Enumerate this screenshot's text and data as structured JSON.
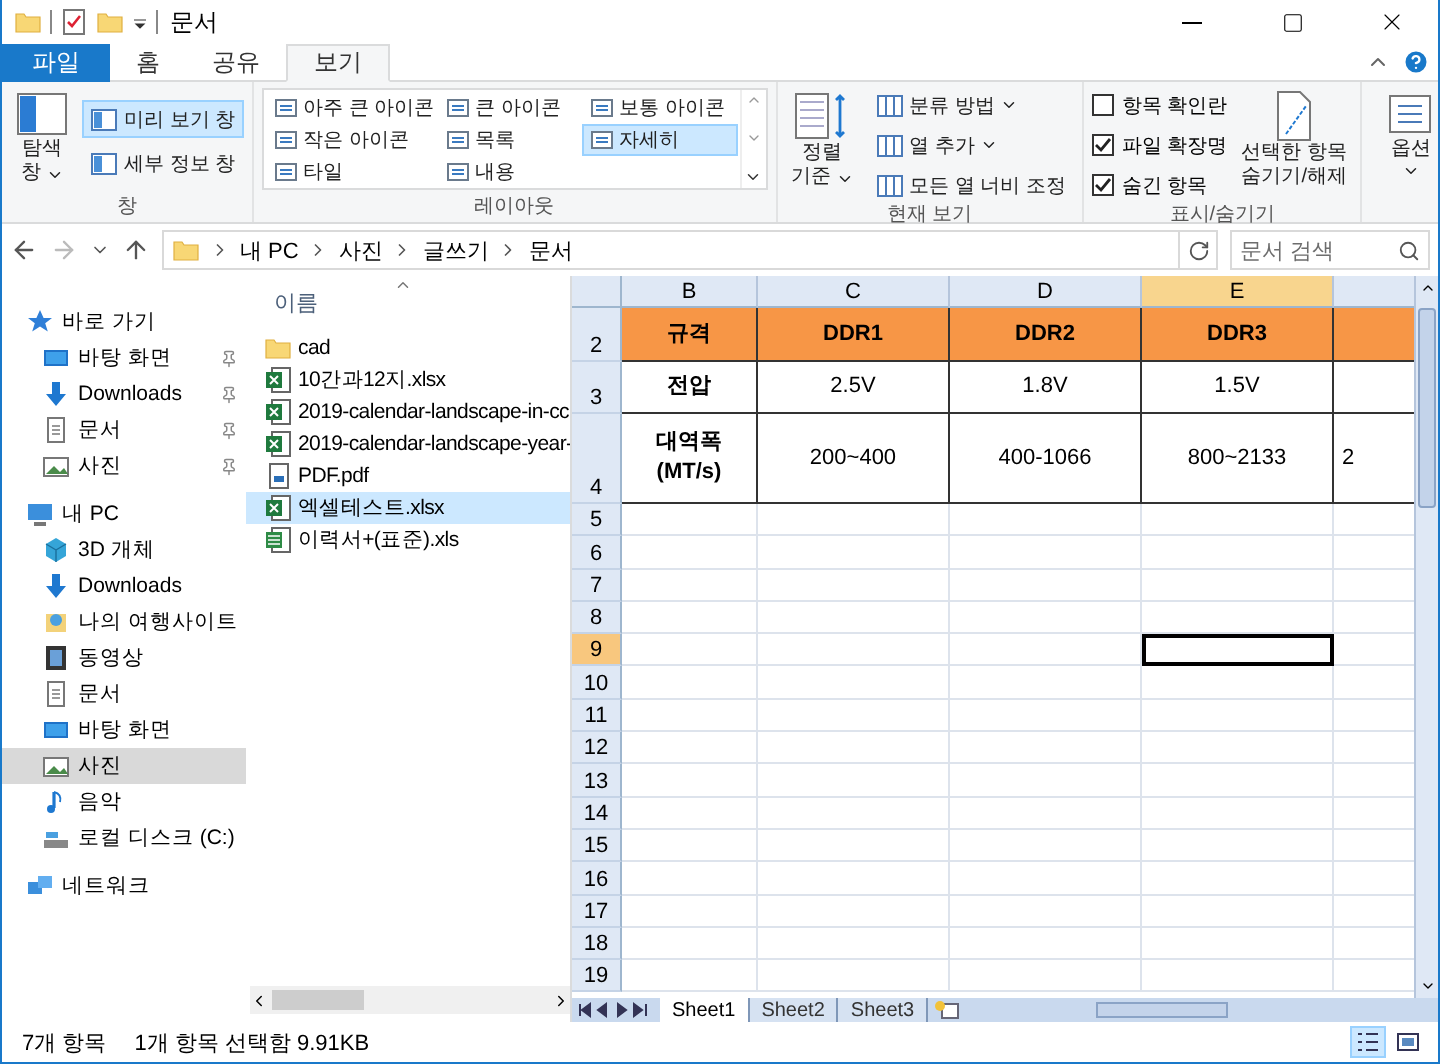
{
  "window": {
    "title": "문서"
  },
  "ribbon_tabs": [
    {
      "label": "파일",
      "kind": "file",
      "selected": false
    },
    {
      "label": "홈",
      "kind": "tab",
      "selected": false
    },
    {
      "label": "공유",
      "kind": "tab",
      "selected": false
    },
    {
      "label": "보기",
      "kind": "tab",
      "selected": true
    }
  ],
  "ribbon": {
    "panes": {
      "label": "창",
      "navigation_pane": [
        "탐색",
        "창"
      ],
      "buttons": [
        {
          "label": "미리 보기 창",
          "selected": true
        },
        {
          "label": "세부 정보 창",
          "selected": false
        }
      ]
    },
    "layout": {
      "label": "레이아웃",
      "options": [
        {
          "label": "아주 큰 아이콘",
          "selected": false
        },
        {
          "label": "큰 아이콘",
          "selected": false
        },
        {
          "label": "보통 아이콘",
          "selected": false
        },
        {
          "label": "작은 아이콘",
          "selected": false
        },
        {
          "label": "목록",
          "selected": false
        },
        {
          "label": "자세히",
          "selected": true
        },
        {
          "label": "타일",
          "selected": false
        },
        {
          "label": "내용",
          "selected": false
        }
      ]
    },
    "current_view": {
      "label": "현재 보기",
      "sort": [
        "정렬",
        "기준"
      ],
      "items": [
        {
          "label": "분류 방법",
          "dropdown": true
        },
        {
          "label": "열 추가",
          "dropdown": true
        },
        {
          "label": "모든 열 너비 조정",
          "dropdown": false
        }
      ]
    },
    "show_hide": {
      "label": "표시/숨기기",
      "checkboxes": [
        {
          "label": "항목 확인란",
          "checked": false
        },
        {
          "label": "파일 확장명",
          "checked": true
        },
        {
          "label": "숨긴 항목",
          "checked": true
        }
      ],
      "hide_selected": [
        "선택한 항목",
        "숨기기/해제"
      ]
    },
    "options": {
      "label": "옵션"
    }
  },
  "address_bar": {
    "path": [
      "내 PC",
      "사진",
      "글쓰기",
      "문서"
    ],
    "search_placeholder": "문서 검색"
  },
  "navigation_pane": [
    {
      "label": "바로 가기",
      "kind": "star",
      "selected": false,
      "children": [
        {
          "label": "바탕 화면",
          "kind": "desktop",
          "pinned": true,
          "selected": false
        },
        {
          "label": "Downloads",
          "kind": "download",
          "pinned": true,
          "selected": false
        },
        {
          "label": "문서",
          "kind": "document",
          "pinned": true,
          "selected": false
        },
        {
          "label": "사진",
          "kind": "picture",
          "pinned": true,
          "selected": false
        }
      ]
    },
    {
      "label": "내 PC",
      "kind": "pc",
      "selected": false,
      "children": [
        {
          "label": "3D 개체",
          "kind": "cube",
          "pinned": false,
          "selected": false
        },
        {
          "label": "Downloads",
          "kind": "download",
          "pinned": false,
          "selected": false
        },
        {
          "label": "나의 여행사이트",
          "kind": "site",
          "pinned": false,
          "selected": false
        },
        {
          "label": "동영상",
          "kind": "video",
          "pinned": false,
          "selected": false
        },
        {
          "label": "문서",
          "kind": "document",
          "pinned": false,
          "selected": false
        },
        {
          "label": "바탕 화면",
          "kind": "desktop",
          "pinned": false,
          "selected": false
        },
        {
          "label": "사진",
          "kind": "picture",
          "pinned": false,
          "selected": true
        },
        {
          "label": "음악",
          "kind": "music",
          "pinned": false,
          "selected": false
        },
        {
          "label": "로컬 디스크 (C:)",
          "kind": "disk",
          "pinned": false,
          "selected": false
        }
      ]
    },
    {
      "label": "네트워크",
      "kind": "network",
      "selected": false
    }
  ],
  "file_list": {
    "column": "이름",
    "files": [
      {
        "name": "cad",
        "kind": "folder",
        "selected": false
      },
      {
        "name": "10간과12지.xlsx",
        "kind": "excel",
        "selected": false
      },
      {
        "name": "2019-calendar-landscape-in-cc",
        "kind": "excel",
        "selected": false
      },
      {
        "name": "2019-calendar-landscape-year-",
        "kind": "excel",
        "selected": false
      },
      {
        "name": "PDF.pdf",
        "kind": "pdf",
        "selected": false
      },
      {
        "name": "엑셀테스트.xlsx",
        "kind": "excel",
        "selected": true
      },
      {
        "name": "이력서+(표준).xls",
        "kind": "xls",
        "selected": false
      }
    ]
  },
  "spreadsheet": {
    "columns": [
      {
        "label": "B",
        "selected": false
      },
      {
        "label": "C",
        "selected": false
      },
      {
        "label": "D",
        "selected": false
      },
      {
        "label": "E",
        "selected": true
      }
    ],
    "rows": [
      {
        "number": "2",
        "kind": "header",
        "selected": false,
        "cells": [
          "규격",
          "DDR1",
          "DDR2",
          "DDR3"
        ]
      },
      {
        "number": "3",
        "kind": "data",
        "selected": false,
        "cells": [
          "전압",
          "2.5V",
          "1.8V",
          "1.5V"
        ]
      },
      {
        "number": "4",
        "kind": "data",
        "selected": false,
        "cells": [
          "대역폭\n(MT/s)",
          "200~400",
          "400-1066",
          "800~2133"
        ],
        "cut_cell": "2"
      },
      {
        "number": "5",
        "kind": "empty",
        "selected": false
      },
      {
        "number": "6",
        "kind": "empty",
        "selected": false
      },
      {
        "number": "7",
        "kind": "empty",
        "selected": false
      },
      {
        "number": "8",
        "kind": "empty",
        "selected": false
      },
      {
        "number": "9",
        "kind": "empty",
        "selected": true
      },
      {
        "number": "10",
        "kind": "empty",
        "selected": false
      },
      {
        "number": "11",
        "kind": "empty",
        "selected": false
      },
      {
        "number": "12",
        "kind": "empty",
        "selected": false
      },
      {
        "number": "13",
        "kind": "empty",
        "selected": false
      },
      {
        "number": "14",
        "kind": "empty",
        "selected": false
      },
      {
        "number": "15",
        "kind": "empty",
        "selected": false
      },
      {
        "number": "16",
        "kind": "empty",
        "selected": false
      },
      {
        "number": "17",
        "kind": "empty",
        "selected": false
      },
      {
        "number": "18",
        "kind": "empty",
        "selected": false
      },
      {
        "number": "19",
        "kind": "empty",
        "selected": false
      }
    ],
    "sheet_tabs": [
      {
        "label": "Sheet1",
        "selected": true
      },
      {
        "label": "Sheet2",
        "selected": false
      },
      {
        "label": "Sheet3",
        "selected": false
      }
    ]
  },
  "status_bar": {
    "item_count": "7개 항목",
    "selection": "1개 항목 선택함 9.91KB",
    "views": [
      {
        "kind": "details",
        "selected": true
      },
      {
        "kind": "thumbnails",
        "selected": false
      }
    ]
  }
}
